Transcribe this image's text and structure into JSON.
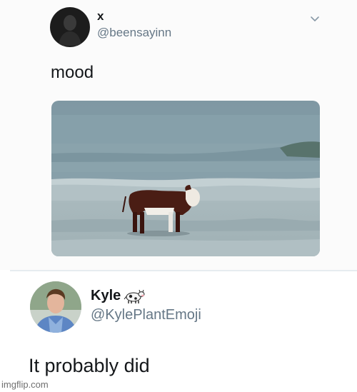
{
  "tweet1": {
    "display_name": "x",
    "handle": "@beensayinn",
    "text": "mood",
    "avatar_icon": "silhouette-avatar-icon",
    "menu_icon": "chevron-down-icon",
    "media_description_icon": "cow-on-beach-photo"
  },
  "tweet2": {
    "display_name": "Kyle",
    "name_emoji": "cow-emoji",
    "handle": "@KylePlantEmoji",
    "text": "It probably did",
    "avatar_icon": "profile-photo-avatar"
  },
  "watermark": {
    "text": "imgflip.com"
  },
  "colors": {
    "text_primary": "#14171a",
    "text_secondary": "#657786",
    "divider": "#e6ecf0",
    "sea": "#8fa6ae",
    "sand": "#a9b6ba",
    "cow_body": "#4a1d14"
  }
}
